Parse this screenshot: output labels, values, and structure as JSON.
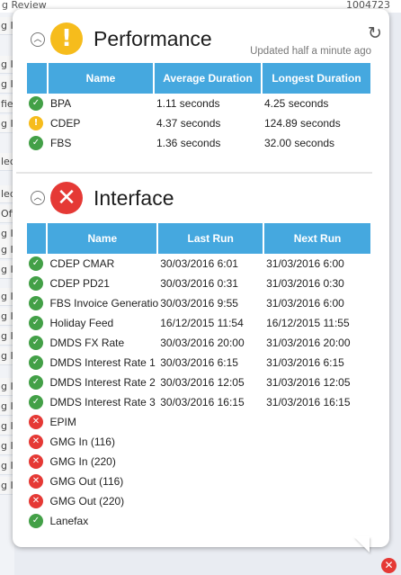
{
  "background": {
    "top_left": "g Review",
    "top_right": "1004723",
    "rows": [
      "g I",
      "g I",
      "g I",
      "fie",
      "g I",
      "led",
      "led",
      "Off",
      "g I",
      "g I",
      "g I",
      "g I",
      "g I",
      "g I",
      "g I",
      "g I",
      "g I",
      "g I",
      "g I",
      "g I",
      "g I"
    ]
  },
  "performance": {
    "title": "Performance",
    "status": "warning",
    "updated": "Updated half a minute ago",
    "columns": [
      "Name",
      "Average Duration",
      "Longest Duration"
    ],
    "rows": [
      {
        "status": "ok",
        "name": "BPA",
        "avg": "1.11 seconds",
        "longest": "4.25 seconds"
      },
      {
        "status": "warn",
        "name": "CDEP",
        "avg": "4.37 seconds",
        "longest": "124.89 seconds"
      },
      {
        "status": "ok",
        "name": "FBS",
        "avg": "1.36 seconds",
        "longest": "32.00 seconds"
      }
    ]
  },
  "interface": {
    "title": "Interface",
    "status": "error",
    "columns": [
      "Name",
      "Last Run",
      "Next Run"
    ],
    "rows": [
      {
        "status": "ok",
        "name": "CDEP CMAR",
        "last": "30/03/2016 6:01",
        "next": "31/03/2016 6:00"
      },
      {
        "status": "ok",
        "name": "CDEP PD21",
        "last": "30/03/2016 0:31",
        "next": "31/03/2016 0:30"
      },
      {
        "status": "ok",
        "name": "FBS Invoice Generatio",
        "last": "30/03/2016 9:55",
        "next": "31/03/2016 6:00"
      },
      {
        "status": "ok",
        "name": "Holiday Feed",
        "last": "16/12/2015 11:54",
        "next": "16/12/2015 11:55"
      },
      {
        "status": "ok",
        "name": "DMDS FX Rate",
        "last": "30/03/2016 20:00",
        "next": "31/03/2016 20:00"
      },
      {
        "status": "ok",
        "name": "DMDS Interest Rate 1",
        "last": "30/03/2016 6:15",
        "next": "31/03/2016 6:15"
      },
      {
        "status": "ok",
        "name": "DMDS Interest Rate 2",
        "last": "30/03/2016 12:05",
        "next": "31/03/2016 12:05"
      },
      {
        "status": "ok",
        "name": "DMDS Interest Rate 3",
        "last": "30/03/2016 16:15",
        "next": "31/03/2016 16:15"
      },
      {
        "status": "error",
        "name": "EPIM",
        "last": "",
        "next": ""
      },
      {
        "status": "error",
        "name": "GMG In (116)",
        "last": "",
        "next": ""
      },
      {
        "status": "error",
        "name": "GMG In (220)",
        "last": "",
        "next": ""
      },
      {
        "status": "error",
        "name": "GMG Out (116)",
        "last": "",
        "next": ""
      },
      {
        "status": "error",
        "name": "GMG Out (220)",
        "last": "",
        "next": ""
      },
      {
        "status": "ok",
        "name": "Lanefax",
        "last": "",
        "next": ""
      }
    ]
  },
  "colors": {
    "header": "#45a8df",
    "ok": "#43a047",
    "warn": "#f6bc1c",
    "error": "#e53935"
  },
  "icons": {
    "ok": "check-icon",
    "warn": "exclamation-icon",
    "error": "x-icon",
    "refresh": "refresh-icon",
    "collapse": "chevron-up-icon"
  }
}
